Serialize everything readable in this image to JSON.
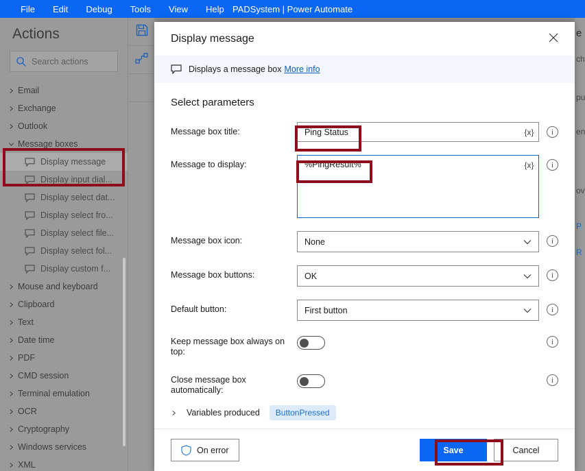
{
  "window": {
    "app_title": "PADSystem | Power Automate",
    "menus": [
      "File",
      "Edit",
      "Debug",
      "Tools",
      "View",
      "Help"
    ],
    "accent_blue": "#0a66f5",
    "annotation_color": "#8c0d1c"
  },
  "sidebar": {
    "heading": "Actions",
    "search": {
      "placeholder": "Search actions",
      "icon": "search-icon"
    },
    "items": [
      {
        "label": "Email",
        "type": "group",
        "expanded": false
      },
      {
        "label": "Exchange",
        "type": "group",
        "expanded": false
      },
      {
        "label": "Outlook",
        "type": "group",
        "expanded": false
      },
      {
        "label": "Message boxes",
        "type": "group",
        "expanded": true,
        "highlighted": true
      },
      {
        "label": "Display message",
        "type": "action",
        "selected": true
      },
      {
        "label": "Display input dial...",
        "type": "action"
      },
      {
        "label": "Display select dat...",
        "type": "action"
      },
      {
        "label": "Display select fro...",
        "type": "action"
      },
      {
        "label": "Display select file...",
        "type": "action"
      },
      {
        "label": "Display select fol...",
        "type": "action"
      },
      {
        "label": "Display custom f...",
        "type": "action"
      },
      {
        "label": "Mouse and keyboard",
        "type": "group",
        "expanded": false
      },
      {
        "label": "Clipboard",
        "type": "group",
        "expanded": false
      },
      {
        "label": "Text",
        "type": "group",
        "expanded": false
      },
      {
        "label": "Date time",
        "type": "group",
        "expanded": false
      },
      {
        "label": "PDF",
        "type": "group",
        "expanded": false
      },
      {
        "label": "CMD session",
        "type": "group",
        "expanded": false
      },
      {
        "label": "Terminal emulation",
        "type": "group",
        "expanded": false
      },
      {
        "label": "OCR",
        "type": "group",
        "expanded": false
      },
      {
        "label": "Cryptography",
        "type": "group",
        "expanded": false
      },
      {
        "label": "Windows services",
        "type": "group",
        "expanded": false
      },
      {
        "label": "XML",
        "type": "group",
        "expanded": false
      }
    ]
  },
  "toolbar": {
    "buttons": [
      {
        "icon": "save-icon"
      },
      {
        "icon": "subflow-icon"
      }
    ]
  },
  "background_right": {
    "fragments": [
      "e",
      "ch",
      "pu",
      "en",
      "ov",
      "P",
      "R"
    ]
  },
  "dialog": {
    "title": "Display message",
    "close_icon": "close-icon",
    "info": {
      "icon": "message-bubble-icon",
      "text": "Displays a message box",
      "link": "More info"
    },
    "section_title": "Select parameters",
    "fields": [
      {
        "label": "Message box title:",
        "control": "text",
        "value": "Ping Status",
        "var_button": "{x}",
        "info_icon": "info-icon",
        "focused": false,
        "annotated": true
      },
      {
        "label": "Message to display:",
        "control": "textarea",
        "value": "%PingResult%",
        "var_button": "{x}",
        "info_icon": "info-icon",
        "focused": true,
        "annotated": true
      },
      {
        "label": "Message box icon:",
        "control": "select",
        "value": "None",
        "info_icon": "info-icon"
      },
      {
        "label": "Message box buttons:",
        "control": "select",
        "value": "OK",
        "info_icon": "info-icon"
      },
      {
        "label": "Default button:",
        "control": "select",
        "value": "First button",
        "info_icon": "info-icon"
      },
      {
        "label": "Keep message box always on top:",
        "control": "toggle",
        "value": "off",
        "info_icon": "info-icon"
      },
      {
        "label": "Close message box automatically:",
        "control": "toggle",
        "value": "off",
        "info_icon": "info-icon"
      }
    ],
    "variables_produced": {
      "label": "Variables produced",
      "chip": "ButtonPressed",
      "expanded": false
    },
    "footer": {
      "on_error_label": "On error",
      "on_error_icon": "shield-icon",
      "save_label": "Save",
      "cancel_label": "Cancel",
      "save_annotated": true
    }
  }
}
